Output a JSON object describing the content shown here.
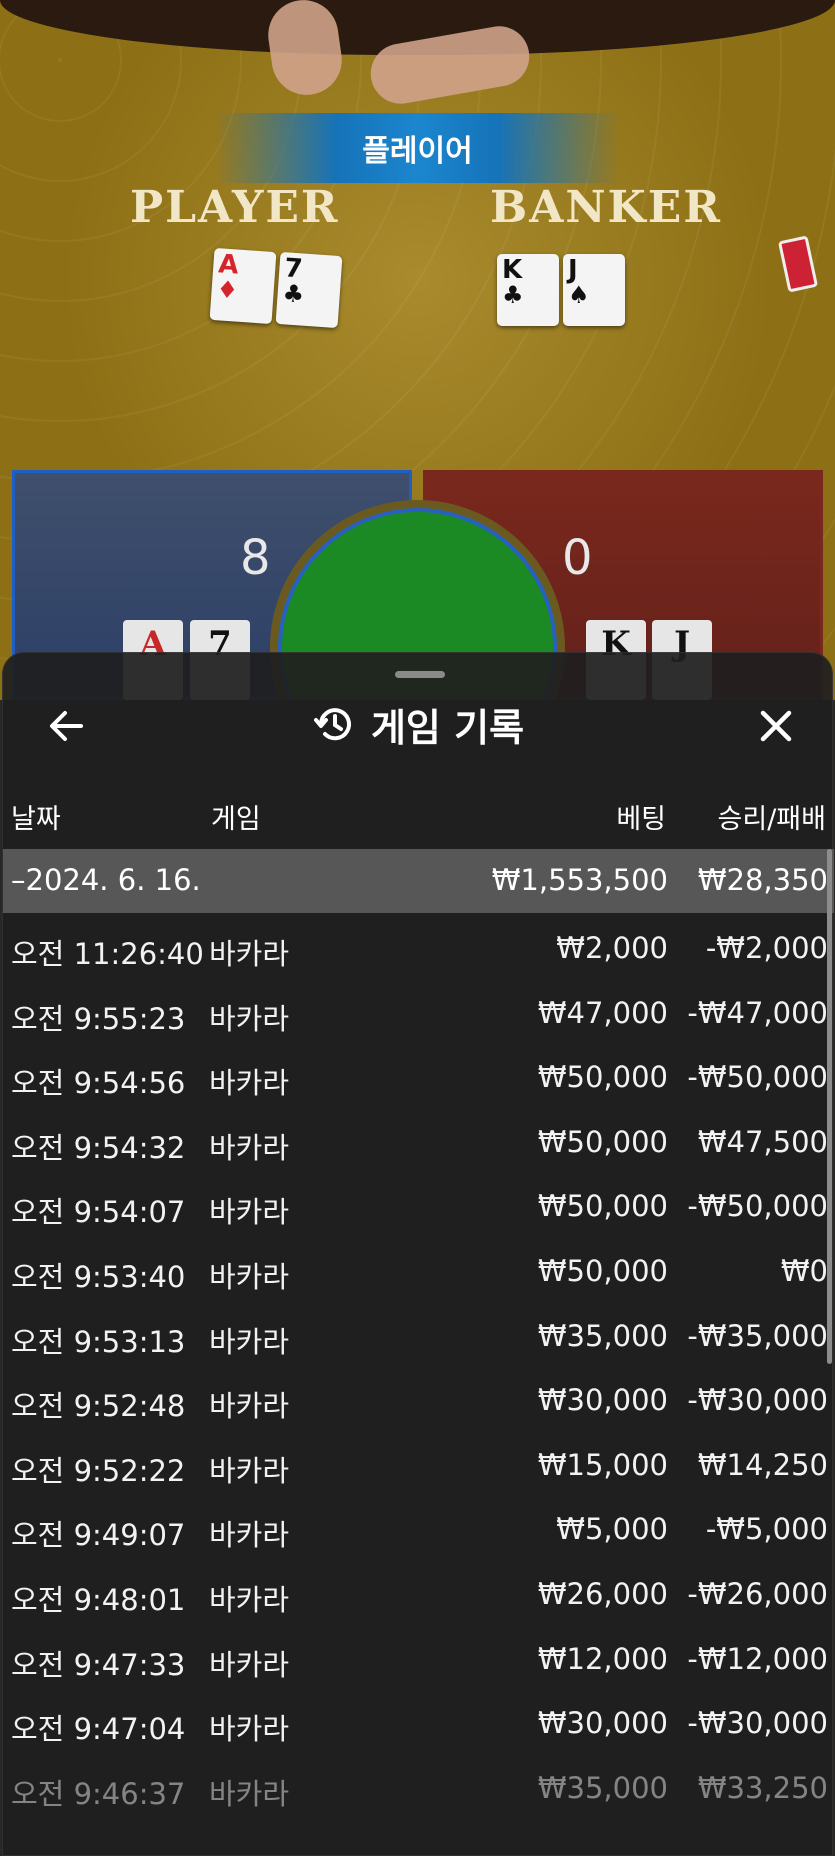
{
  "scene": {
    "banner_text": "플레이어",
    "player_label": "PLAYER",
    "banker_label": "BANKER",
    "player_cards": [
      {
        "rank": "A",
        "suit": "♦",
        "color": "red"
      },
      {
        "rank": "7",
        "suit": "♣",
        "color": "black"
      }
    ],
    "banker_cards": [
      {
        "rank": "K",
        "suit": "♣",
        "color": "black"
      },
      {
        "rank": "J",
        "suit": "♠",
        "color": "black"
      }
    ],
    "player_score": "8",
    "banker_score": "0",
    "mini_player": [
      "A",
      "7"
    ],
    "mini_banker": [
      "K",
      "J"
    ]
  },
  "sheet": {
    "title": "게임 기록",
    "columns": {
      "date": "날짜",
      "game": "게임",
      "bet": "베팅",
      "win_loss": "승리/패배"
    },
    "summary": {
      "date": "–2024. 6. 16.",
      "bet": "₩1,553,500",
      "win_loss": "₩28,350"
    },
    "rows": [
      {
        "time": "오전 11:26:40",
        "game": "바카라",
        "bet": "₩2,000",
        "win_loss": "-₩2,000"
      },
      {
        "time": "오전 9:55:23",
        "game": "바카라",
        "bet": "₩47,000",
        "win_loss": "-₩47,000"
      },
      {
        "time": "오전 9:54:56",
        "game": "바카라",
        "bet": "₩50,000",
        "win_loss": "-₩50,000"
      },
      {
        "time": "오전 9:54:32",
        "game": "바카라",
        "bet": "₩50,000",
        "win_loss": "₩47,500"
      },
      {
        "time": "오전 9:54:07",
        "game": "바카라",
        "bet": "₩50,000",
        "win_loss": "-₩50,000"
      },
      {
        "time": "오전 9:53:40",
        "game": "바카라",
        "bet": "₩50,000",
        "win_loss": "₩0"
      },
      {
        "time": "오전 9:53:13",
        "game": "바카라",
        "bet": "₩35,000",
        "win_loss": "-₩35,000"
      },
      {
        "time": "오전 9:52:48",
        "game": "바카라",
        "bet": "₩30,000",
        "win_loss": "-₩30,000"
      },
      {
        "time": "오전 9:52:22",
        "game": "바카라",
        "bet": "₩15,000",
        "win_loss": "₩14,250"
      },
      {
        "time": "오전 9:49:07",
        "game": "바카라",
        "bet": "₩5,000",
        "win_loss": "-₩5,000"
      },
      {
        "time": "오전 9:48:01",
        "game": "바카라",
        "bet": "₩26,000",
        "win_loss": "-₩26,000"
      },
      {
        "time": "오전 9:47:33",
        "game": "바카라",
        "bet": "₩12,000",
        "win_loss": "-₩12,000"
      },
      {
        "time": "오전 9:47:04",
        "game": "바카라",
        "bet": "₩30,000",
        "win_loss": "-₩30,000"
      },
      {
        "time": "오전 9:46:37",
        "game": "바카라",
        "bet": "₩35,000",
        "win_loss": "₩33,250"
      }
    ]
  },
  "icons": {
    "back": "arrow-left-icon",
    "history": "history-icon",
    "close": "close-icon"
  }
}
